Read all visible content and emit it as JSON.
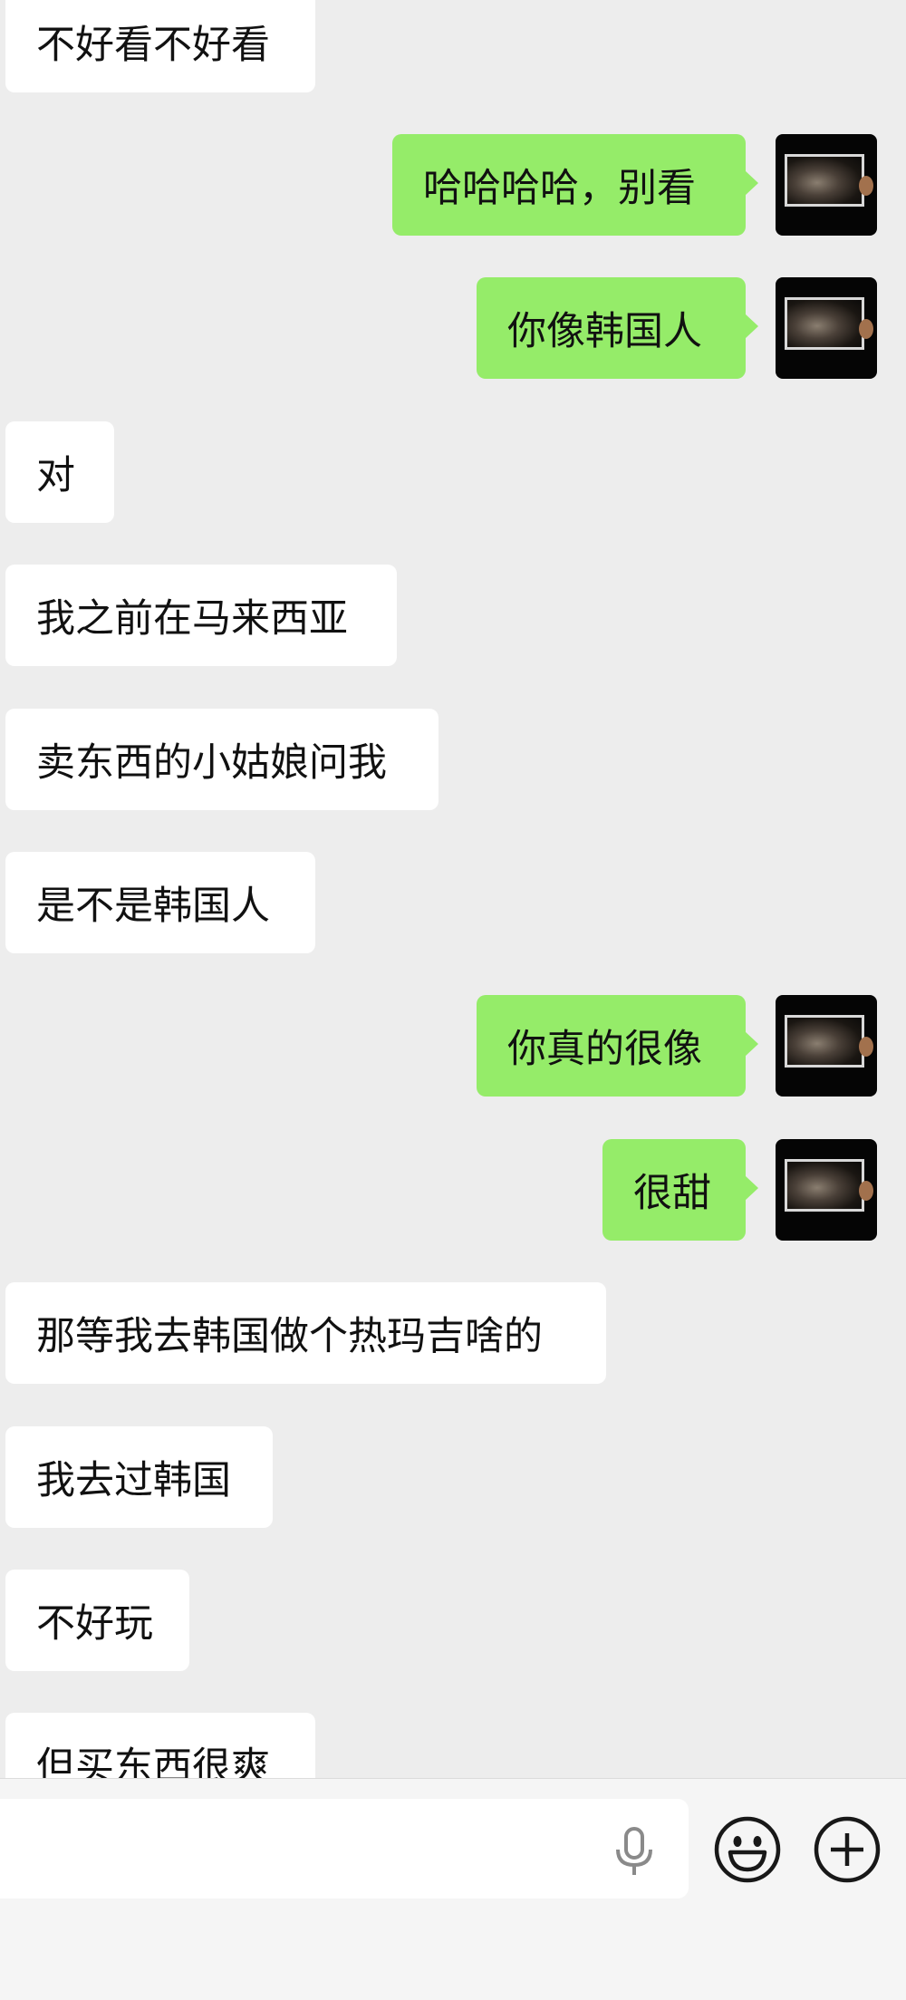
{
  "messages": [
    {
      "side": "in",
      "text": "不好看不好看"
    },
    {
      "side": "out",
      "text": "哈哈哈哈，别看"
    },
    {
      "side": "out",
      "text": "你像韩国人"
    },
    {
      "side": "in",
      "text": "对"
    },
    {
      "side": "in",
      "text": "我之前在马来西亚"
    },
    {
      "side": "in",
      "text": "卖东西的小姑娘问我"
    },
    {
      "side": "in",
      "text": "是不是韩国人"
    },
    {
      "side": "out",
      "text": "你真的很像"
    },
    {
      "side": "out",
      "text": "很甜"
    },
    {
      "side": "in",
      "text": "那等我去韩国做个热玛吉啥的"
    },
    {
      "side": "in",
      "text": "我去过韩国"
    },
    {
      "side": "in",
      "text": "不好玩"
    },
    {
      "side": "in",
      "text": "但买东西很爽"
    }
  ],
  "input": {
    "value": "",
    "mic_icon": "microphone-icon",
    "emoji_icon": "emoji-face-icon",
    "plus_icon": "plus-circle-icon"
  },
  "colors": {
    "background": "#ededed",
    "incoming_bubble": "#ffffff",
    "outgoing_bubble": "#95ec69"
  }
}
